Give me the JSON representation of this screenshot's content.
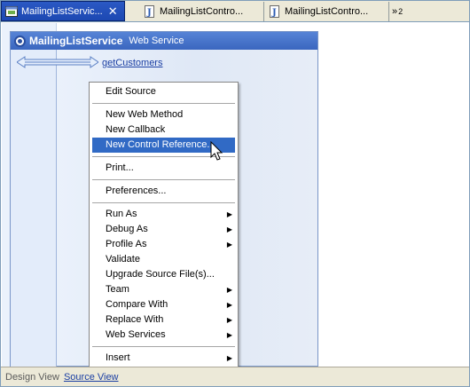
{
  "tabs": [
    {
      "label": "MailingListServic...",
      "icon": "web-service-file-icon",
      "active": true,
      "close_glyph": "✕"
    },
    {
      "label": "MailingListContro...",
      "icon": "java-file-icon",
      "active": false
    },
    {
      "label": "MailingListContro...",
      "icon": "java-file-icon",
      "active": false
    }
  ],
  "tab_overflow": {
    "glyph": "»",
    "count": "2"
  },
  "service": {
    "title": "MailingListService",
    "type": "Web Service",
    "icon": "gear-icon",
    "method": "getCustomers"
  },
  "context_menu": {
    "items": [
      {
        "label": "Edit Source"
      },
      {
        "separator": true
      },
      {
        "label": "New Web Method"
      },
      {
        "label": "New Callback"
      },
      {
        "label": "New Control Reference...",
        "highlighted": true
      },
      {
        "separator": true
      },
      {
        "label": "Print..."
      },
      {
        "separator": true
      },
      {
        "label": "Preferences..."
      },
      {
        "separator": true
      },
      {
        "label": "Run As",
        "submenu": true
      },
      {
        "label": "Debug As",
        "submenu": true
      },
      {
        "label": "Profile As",
        "submenu": true
      },
      {
        "label": "Validate"
      },
      {
        "label": "Upgrade Source File(s)..."
      },
      {
        "label": "Team",
        "submenu": true
      },
      {
        "label": "Compare With",
        "submenu": true
      },
      {
        "label": "Replace With",
        "submenu": true
      },
      {
        "label": "Web Services",
        "submenu": true
      },
      {
        "separator": true
      },
      {
        "label": "Insert",
        "submenu": true
      }
    ]
  },
  "bottom_views": {
    "design": "Design View",
    "source": "Source View"
  },
  "colors": {
    "accent": "#316ac5",
    "header": "#3a66bf",
    "link": "#1b3fa3",
    "tab_active": "#2b59c4"
  }
}
